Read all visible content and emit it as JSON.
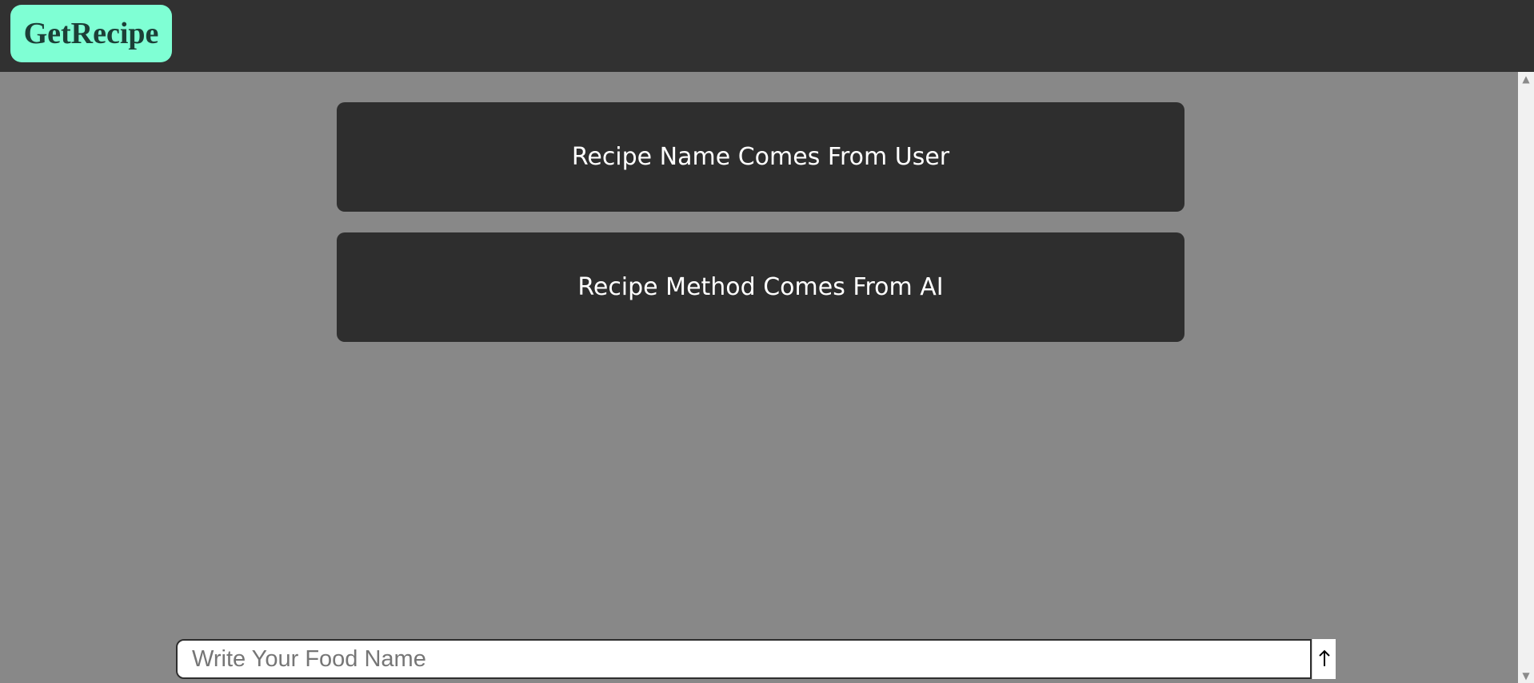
{
  "header": {
    "logo_text": "GetRecipe"
  },
  "cards": {
    "recipe_name": "Recipe Name Comes From User",
    "recipe_method": "Recipe Method Comes From AI"
  },
  "input": {
    "placeholder": "Write Your Food Name",
    "value": ""
  },
  "icons": {
    "send": "arrow-up-icon",
    "scroll_up": "scroll-up-arrow-icon",
    "scroll_down": "scroll-down-arrow-icon"
  },
  "colors": {
    "page_background": "#888888",
    "topbar_background": "#313131",
    "logo_background": "#7fffd4",
    "logo_text": "#1c3f37",
    "card_background": "#2e2e2e",
    "card_text": "#ffffff"
  }
}
